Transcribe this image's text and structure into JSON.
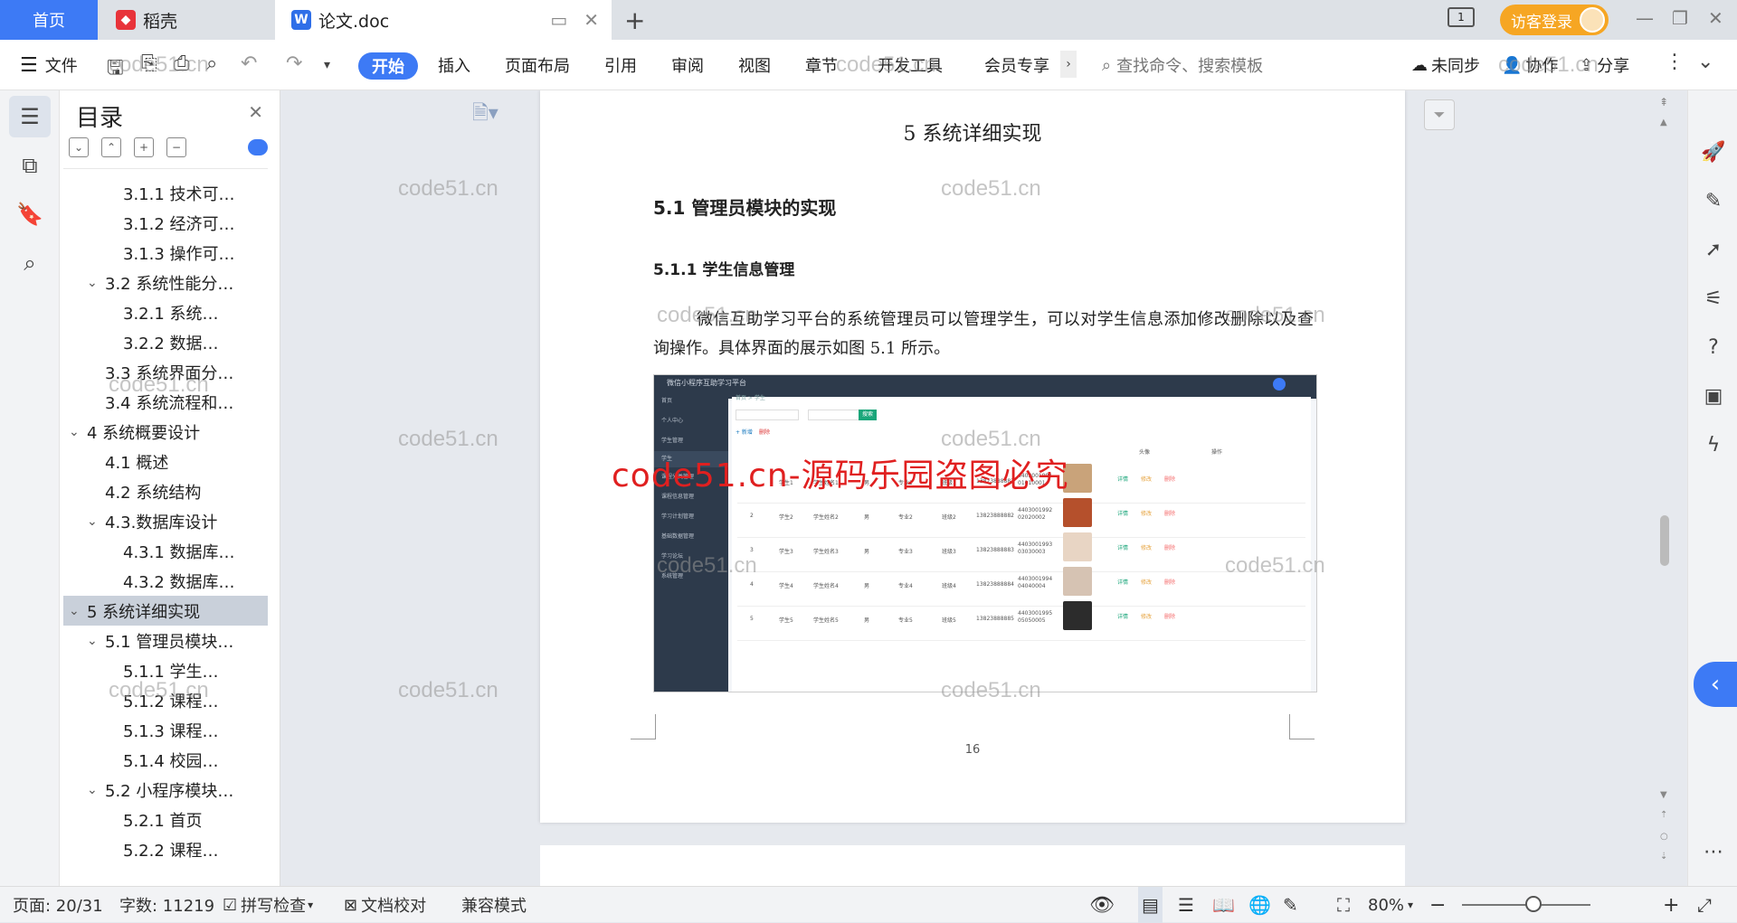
{
  "tabs": {
    "home": "首页",
    "docer": "稻壳",
    "doc": "论文.doc",
    "new_tab": "+"
  },
  "titlebar": {
    "page_count_badge": "1",
    "visitor_login": "访客登录"
  },
  "toolbar": {
    "file": "文件",
    "menu": [
      "开始",
      "插入",
      "页面布局",
      "引用",
      "审阅",
      "视图",
      "章节",
      "开发工具",
      "会员专享"
    ],
    "search_placeholder": "查找命令、搜索模板",
    "not_synced": "未同步",
    "collaborate": "协作",
    "share": "分享"
  },
  "toc": {
    "title": "目录",
    "items": [
      {
        "label": "3.1.1 技术可…",
        "level": 3,
        "expanded": null
      },
      {
        "label": "3.1.2 经济可…",
        "level": 3,
        "expanded": null
      },
      {
        "label": "3.1.3 操作可…",
        "level": 3,
        "expanded": null
      },
      {
        "label": "3.2 系统性能分…",
        "level": 2,
        "expanded": true
      },
      {
        "label": "3.2.1  系统…",
        "level": 3,
        "expanded": null
      },
      {
        "label": "3.2.2  数据…",
        "level": 3,
        "expanded": null
      },
      {
        "label": "3.3 系统界面分…",
        "level": 2,
        "expanded": null
      },
      {
        "label": "3.4 系统流程和…",
        "level": 2,
        "expanded": null
      },
      {
        "label": "4 系统概要设计",
        "level": 1,
        "expanded": true
      },
      {
        "label": "4.1 概述",
        "level": 2,
        "expanded": null
      },
      {
        "label": "4.2 系统结构",
        "level": 2,
        "expanded": null
      },
      {
        "label": "4.3.数据库设计",
        "level": 2,
        "expanded": true
      },
      {
        "label": "4.3.1 数据库…",
        "level": 3,
        "expanded": null
      },
      {
        "label": "4.3.2 数据库…",
        "level": 3,
        "expanded": null
      },
      {
        "label": "5 系统详细实现",
        "level": 1,
        "expanded": true,
        "selected": true
      },
      {
        "label": "5.1  管理员模块…",
        "level": 2,
        "expanded": true
      },
      {
        "label": "5.1.1  学生…",
        "level": 3,
        "expanded": null
      },
      {
        "label": "5.1.2  课程…",
        "level": 3,
        "expanded": null
      },
      {
        "label": "5.1.3  课程…",
        "level": 3,
        "expanded": null
      },
      {
        "label": "5.1.4  校园…",
        "level": 3,
        "expanded": null
      },
      {
        "label": "5.2  小程序模块…",
        "level": 2,
        "expanded": true
      },
      {
        "label": "5.2.1  首页",
        "level": 3,
        "expanded": null
      },
      {
        "label": "5.2.2  课程…",
        "level": 3,
        "expanded": null
      }
    ]
  },
  "document": {
    "chapter_title": "5 系统详细实现",
    "section_title": "5.1  管理员模块的实现",
    "subsection_title": "5.1.1  学生信息管理",
    "paragraph": "微信互助学习平台的系统管理员可以管理学生，可以对学生信息添加修改删除以及查询操作。具体界面的展示如图 5.1 所示。",
    "page_number": "16"
  },
  "embedded_screenshot": {
    "app_title": "微信小程序互助学习平台",
    "breadcrumb": "首页 > 学生",
    "search_btn": "搜索",
    "add_btn": "+ 新增",
    "delete_btn": "删除",
    "menu": [
      "首页",
      "个人中心",
      "学生管理",
      "学生",
      "课程分类管理",
      "课程信息管理",
      "学习计划管理",
      "基础数据管理",
      "学习论坛",
      "系统管理"
    ],
    "columns": [
      "头像",
      "操作"
    ],
    "rows": [
      {
        "no": "1",
        "account": "学生1",
        "name": "学生姓名1",
        "gender": "男",
        "major": "专业1",
        "class": "班级1",
        "phone": "13823888881",
        "idcard": "440300199101010001"
      },
      {
        "no": "2",
        "account": "学生2",
        "name": "学生姓名2",
        "gender": "男",
        "major": "专业2",
        "class": "班级2",
        "phone": "13823888882",
        "idcard": "440300199202020002"
      },
      {
        "no": "3",
        "account": "学生3",
        "name": "学生姓名3",
        "gender": "男",
        "major": "专业3",
        "class": "班级3",
        "phone": "13823888883",
        "idcard": "440300199303030003"
      },
      {
        "no": "4",
        "account": "学生4",
        "name": "学生姓名4",
        "gender": "男",
        "major": "专业4",
        "class": "班级4",
        "phone": "13823888884",
        "idcard": "440300199404040004"
      },
      {
        "no": "5",
        "account": "学生5",
        "name": "学生姓名5",
        "gender": "男",
        "major": "专业5",
        "class": "班级5",
        "phone": "13823888885",
        "idcard": "440300199505050005"
      }
    ],
    "actions": [
      "详情",
      "修改",
      "删除"
    ]
  },
  "watermarks": {
    "small": "code51.cn",
    "big": "code51.cn-源码乐园盗图必究"
  },
  "statusbar": {
    "page": "页面: 20/31",
    "words": "字数: 11219",
    "spellcheck": "拼写检查",
    "proofread": "文档校对",
    "compat": "兼容模式",
    "zoom": "80%"
  },
  "colors": {
    "accent": "#3d7af5",
    "visitor": "#f6a623",
    "watermark_red": "#e02020",
    "sidebar_dark": "#2d3a4b"
  }
}
